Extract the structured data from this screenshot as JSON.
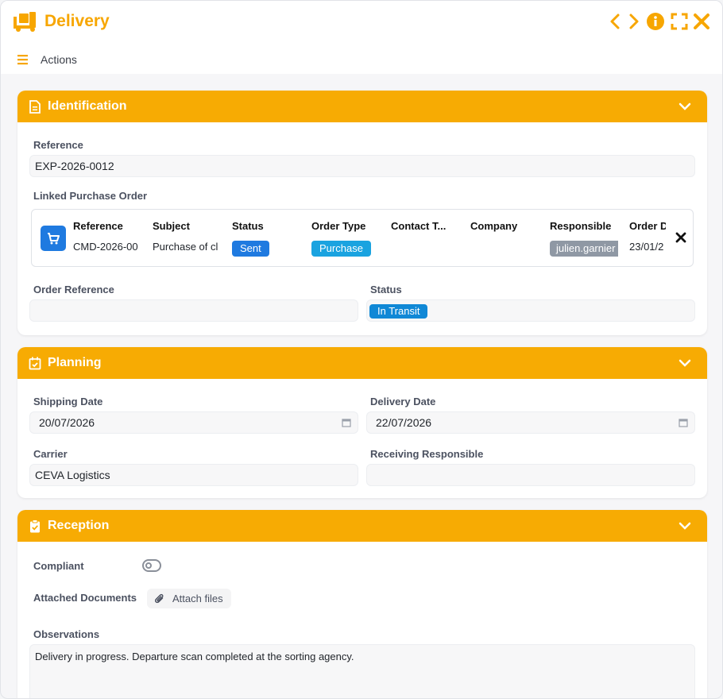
{
  "window": {
    "title": "Delivery",
    "accent_color": "#f7a600",
    "controls": [
      "previous-icon",
      "next-icon",
      "info-icon",
      "fullscreen-icon",
      "close-icon"
    ]
  },
  "toolbar": {
    "actions_label": "Actions"
  },
  "identification": {
    "title": "Identification",
    "reference_label": "Reference",
    "reference_value": "EXP-2026-0012",
    "linked_po_label": "Linked Purchase Order",
    "po_columns": [
      "Reference",
      "Subject",
      "Status",
      "Order Type",
      "Contact T...",
      "Company",
      "Responsible",
      "Order D"
    ],
    "po_row": {
      "reference": "CMD-2026-00",
      "subject": "Purchase of cl",
      "status": "Sent",
      "status_color": "#1f7ae0",
      "order_type": "Purchase",
      "order_type_color": "#1aa3e0",
      "contact": "",
      "company": "",
      "responsible": "julien.garnier",
      "order_date": "23/01/2"
    },
    "order_reference_label": "Order Reference",
    "order_reference_value": "",
    "status_label": "Status",
    "status_value": "In Transit",
    "status_color": "#1088d6"
  },
  "planning": {
    "title": "Planning",
    "shipping_date_label": "Shipping Date",
    "shipping_date_value": "20/07/2026",
    "delivery_date_label": "Delivery Date",
    "delivery_date_value": "22/07/2026",
    "carrier_label": "Carrier",
    "carrier_value": "CEVA Logistics",
    "receiving_responsible_label": "Receiving Responsible",
    "receiving_responsible_value": ""
  },
  "reception": {
    "title": "Reception",
    "compliant_label": "Compliant",
    "compliant_value": false,
    "attached_documents_label": "Attached Documents",
    "attach_button_label": "Attach files",
    "observations_label": "Observations",
    "observations_value": "Delivery in progress. Departure scan completed at the sorting agency."
  }
}
